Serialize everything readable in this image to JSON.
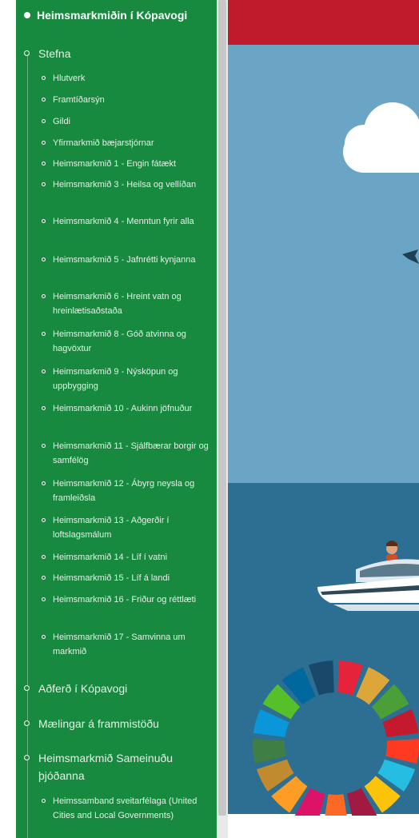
{
  "sidebar": {
    "title": "Heimsmarkmiðin í Kópavogi",
    "stefna": {
      "label": "Stefna",
      "items": [
        {
          "label": "Hlutverk"
        },
        {
          "label": "Framtíðarsýn"
        },
        {
          "label": "Gildi"
        },
        {
          "label": "Yfirmarkmið bæjarstjórnar"
        },
        {
          "label": "Heimsmarkmið 1 - Engin fátækt"
        },
        {
          "label": "Heimsmarkmið 3 - Heilsa og vellíðan"
        },
        {
          "label": "Heimsmarkmið 4 - Menntun fyrir alla"
        },
        {
          "label": "Heimsmarkmið 5 - Jafnrétti kynjanna"
        },
        {
          "label": "Heimsmarkmið 6 - Hreint vatn og hreinlætisaðstaða"
        },
        {
          "label": "Heimsmarkmið 8 - Góð atvinna og hagvöxtur"
        },
        {
          "label": "Heimsmarkmið 9 - Nýsköpun og uppbygging"
        },
        {
          "label": "Heimsmarkmið 10 - Aukinn jöfnuður"
        },
        {
          "label": "Heimsmarkmið 11 - Sjálfbærar borgir og samfélög"
        },
        {
          "label": "Heimsmarkmið 12 - Ábyrg neysla og framleiðsla"
        },
        {
          "label": "Heimsmarkmið 13 - Aðgerðir í loftslagsmálum"
        },
        {
          "label": "Heimsmarkmið 14 - Líf í vatni"
        },
        {
          "label": "Heimsmarkmið 15 - Líf á landi"
        },
        {
          "label": "Heimsmarkmið 16 - Friður og réttlæti"
        },
        {
          "label": "Heimsmarkmið 17 - Samvinna um markmið"
        }
      ]
    },
    "adferd": {
      "label": "Aðferð í Kópavogi"
    },
    "maelingar": {
      "label": "Mælingar á frammistöðu"
    },
    "sameinudu": {
      "label": "Heimsmarkmið Sameinuðu þjóðanna",
      "items": [
        {
          "label": "Heimssamband sveitarfélaga (United Cities and Local Governments)"
        }
      ]
    }
  },
  "colors": {
    "sidebar_bg": "#188a3f",
    "hero_red": "#bf1b2c",
    "sky": "#6aa5c5",
    "sea": "#2c6f93"
  }
}
